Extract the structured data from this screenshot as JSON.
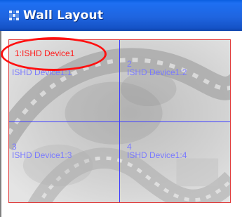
{
  "window": {
    "title": "Wall Layout"
  },
  "wall": {
    "selected_label": "1:ISHD Device1",
    "cells": [
      {
        "number": "",
        "name": "ISHD Device1:1"
      },
      {
        "number": "2",
        "name": "ISHD Device1:2"
      },
      {
        "number": "3",
        "name": "ISHD Device1:3"
      },
      {
        "number": "4",
        "name": "ISHD Device1:4"
      }
    ]
  },
  "colors": {
    "titlebar": "#1f65e0",
    "wall_border": "#e03a3a",
    "grid_lines": "#4040ff",
    "cell_text": "#7a7aff",
    "selected_text": "#ff1a1a",
    "highlight_ring": "#ff1010"
  },
  "icons": {
    "app": "grid-icon"
  }
}
